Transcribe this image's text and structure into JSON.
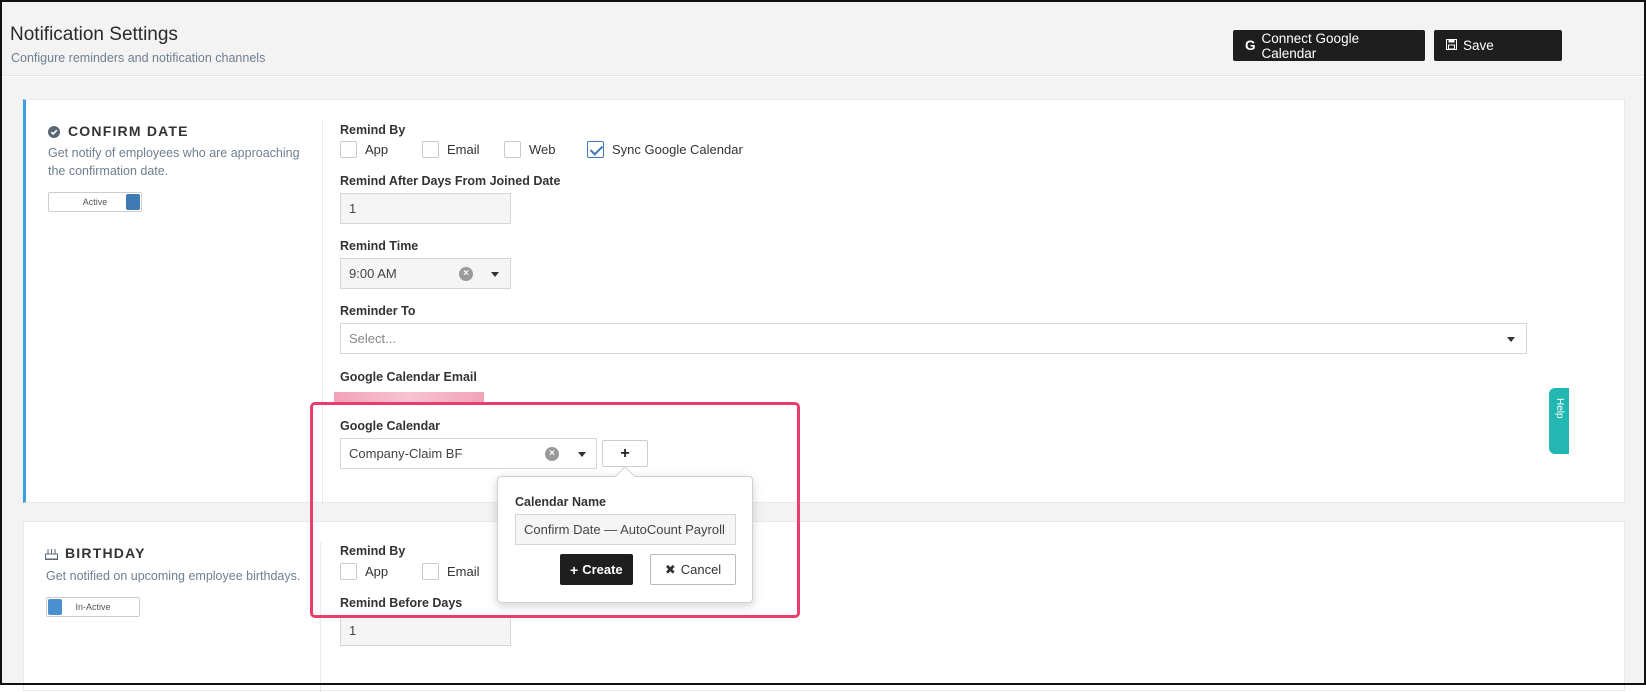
{
  "header": {
    "title": "Notification Settings",
    "subtitle": "Configure reminders and notification channels",
    "connect_label": "Connect Google Calendar",
    "save_label": "Save"
  },
  "confirm_date": {
    "title": "CONFIRM DATE",
    "description": "Get notify of employees who are approaching the confirmation date.",
    "status": "Active",
    "remind_by_label": "Remind By",
    "channels": [
      {
        "label": "App",
        "checked": false
      },
      {
        "label": "Email",
        "checked": false
      },
      {
        "label": "Web",
        "checked": false
      },
      {
        "label": "Sync Google Calendar",
        "checked": true
      }
    ],
    "days_label": "Remind After Days From Joined Date",
    "days_value": "1",
    "time_label": "Remind Time",
    "time_value": "9:00 AM",
    "reminder_to_label": "Reminder To",
    "reminder_to_placeholder": "Select...",
    "gcal_email_label": "Google Calendar Email",
    "gcal_label": "Google Calendar",
    "gcal_value": "Company-Claim BF",
    "add_label": "+"
  },
  "popover": {
    "name_label": "Calendar Name",
    "name_value": "Confirm Date — AutoCount Payroll",
    "create_label": "Create",
    "cancel_label": "Cancel"
  },
  "birthday": {
    "title": "BIRTHDAY",
    "description": "Get notified on upcoming employee birthdays.",
    "status": "In-Active",
    "remind_by_label": "Remind By",
    "channels": [
      {
        "label": "App",
        "checked": false
      },
      {
        "label": "Email",
        "checked": false
      }
    ],
    "days_label": "Remind Before Days",
    "days_value": "1"
  },
  "help_tab_label": "Help",
  "colors": {
    "accent_blue": "#3f79b5",
    "highlight_pink": "#ea3d6c",
    "dark_button": "#1e1e1e",
    "help_teal": "#23b7b2"
  }
}
